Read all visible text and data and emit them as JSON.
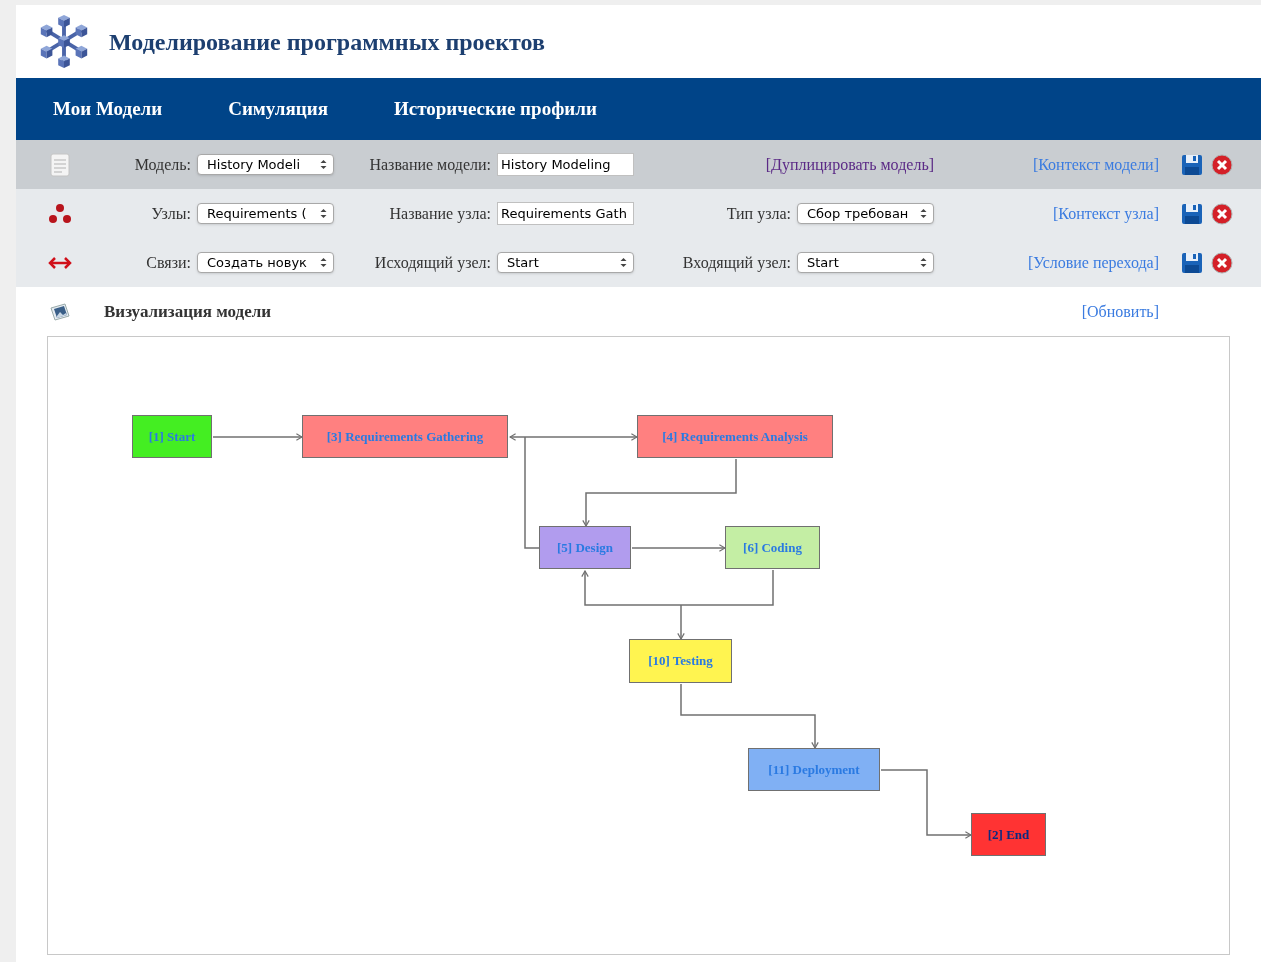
{
  "header": {
    "title": "Моделирование программных проектов"
  },
  "nav": [
    {
      "label": "Мои Модели"
    },
    {
      "label": "Симуляция"
    },
    {
      "label": "Исторические профили"
    }
  ],
  "toolbar_rows": [
    {
      "kind": "model",
      "items": [
        {
          "kind": "select",
          "label": "Модель:",
          "value": "History Modeli"
        },
        {
          "kind": "input",
          "label": "Название модели:",
          "value": "History Modeling"
        },
        {
          "kind": "link",
          "text": "[Дуплицировать модель]",
          "visited": true
        }
      ],
      "context_link": "[Контекст модели]"
    },
    {
      "kind": "node",
      "items": [
        {
          "kind": "select",
          "label": "Узлы:",
          "value": "Requirements ("
        },
        {
          "kind": "input",
          "label": "Название узла:",
          "value": "Requirements Gath"
        },
        {
          "kind": "select",
          "label": "Тип узла:",
          "value": "Сбор требован"
        }
      ],
      "context_link": "[Контекст узла]"
    },
    {
      "kind": "link",
      "items": [
        {
          "kind": "select",
          "label": "Связи:",
          "value": "Создать новук"
        },
        {
          "kind": "select",
          "label": "Исходящий узел:",
          "value": "Start"
        },
        {
          "kind": "select",
          "label": "Входящий узел:",
          "value": "Start"
        }
      ],
      "context_link": "[Условие перехода]"
    }
  ],
  "visualization": {
    "title": "Визуализация модели",
    "refresh_link": "[Обновить]",
    "nodes": [
      {
        "label": "[1] Start",
        "color": "#44ee22"
      },
      {
        "label": "[3] Requirements Gathering",
        "color": "#ff8080"
      },
      {
        "label": "[4] Requirements Analysis",
        "color": "#ff8080"
      },
      {
        "label": "[5] Design",
        "color": "#b19cee"
      },
      {
        "label": "[6] Coding",
        "color": "#c4eea4"
      },
      {
        "label": "[10] Testing",
        "color": "#fff450"
      },
      {
        "label": "[11] Deployment",
        "color": "#80b0f4"
      },
      {
        "label": "[2] End",
        "color": "#ff3333"
      }
    ]
  }
}
